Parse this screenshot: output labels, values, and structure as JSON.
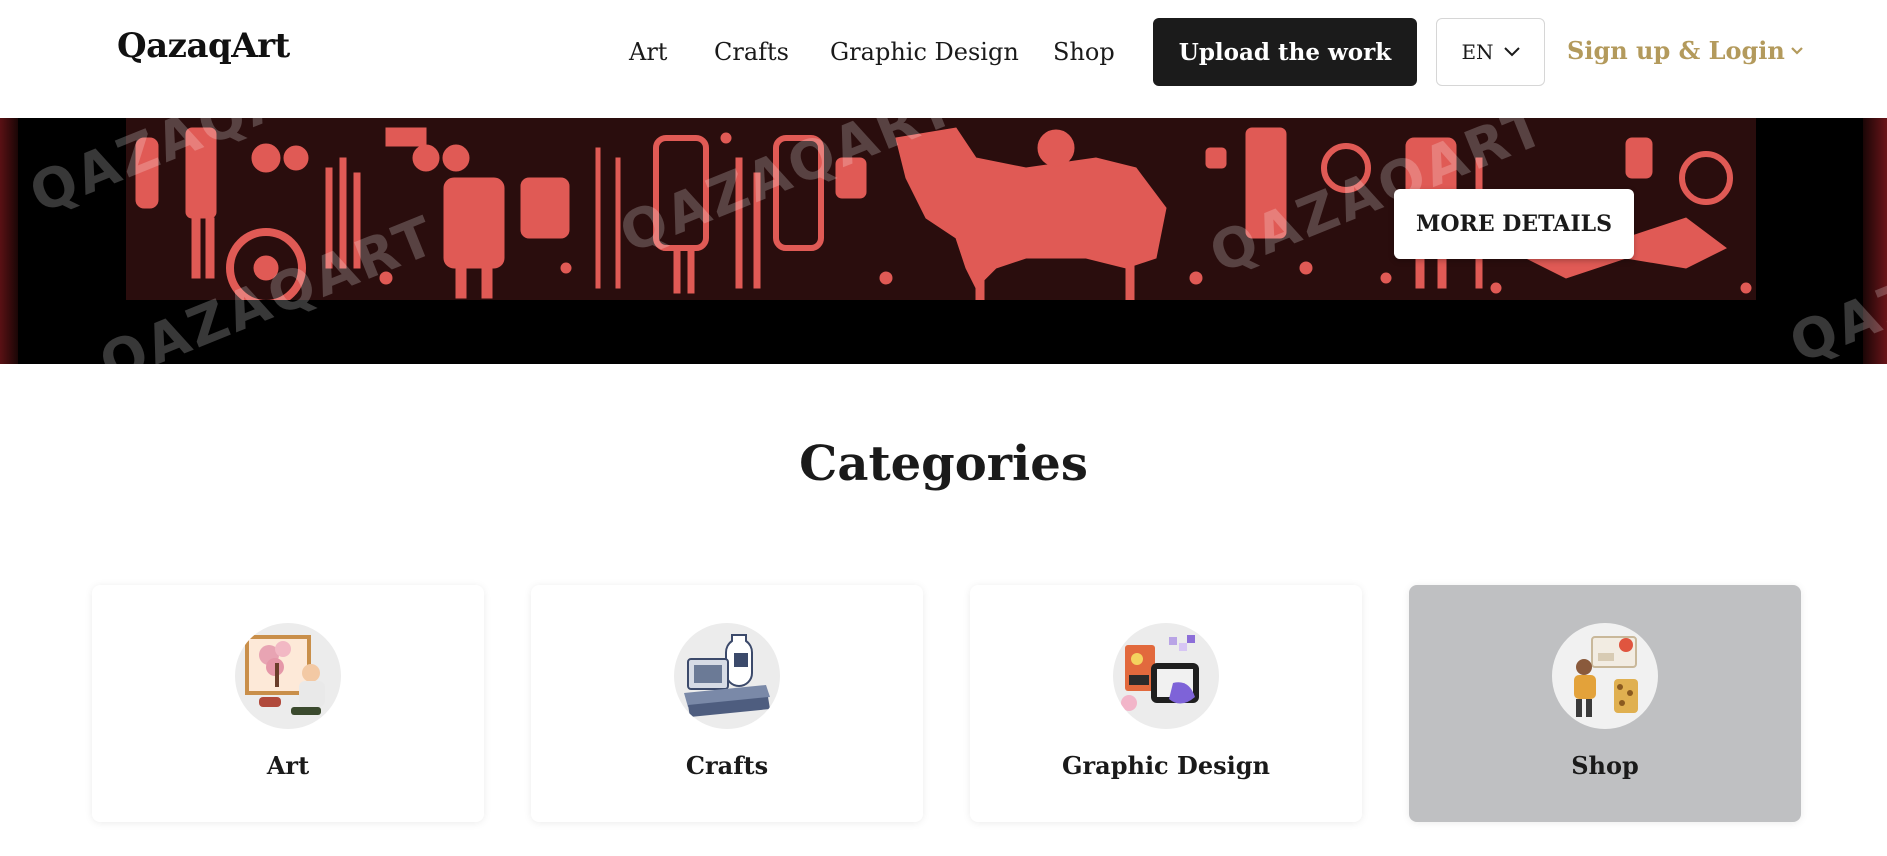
{
  "header": {
    "logo": "QazaqArt",
    "nav": [
      "Art",
      "Crafts",
      "Graphic Design",
      "Shop"
    ],
    "upload_label": "Upload the work",
    "lang": "EN",
    "signup_label": "Sign up & Login"
  },
  "hero": {
    "watermark": "QAZAQART",
    "more_details_label": "MORE DETAILS"
  },
  "categories": {
    "title": "Categories",
    "items": [
      {
        "label": "Art",
        "icon": "art-illustration"
      },
      {
        "label": "Crafts",
        "icon": "crafts-illustration"
      },
      {
        "label": "Graphic Design",
        "icon": "graphic-design-illustration"
      },
      {
        "label": "Shop",
        "icon": "shop-illustration"
      }
    ],
    "selected": "Shop"
  },
  "colors": {
    "accent_gold": "#b39a5c",
    "button_dark": "#1b1b1b",
    "hero_red": "#e05a55",
    "selected_card": "#bfc0c2"
  }
}
